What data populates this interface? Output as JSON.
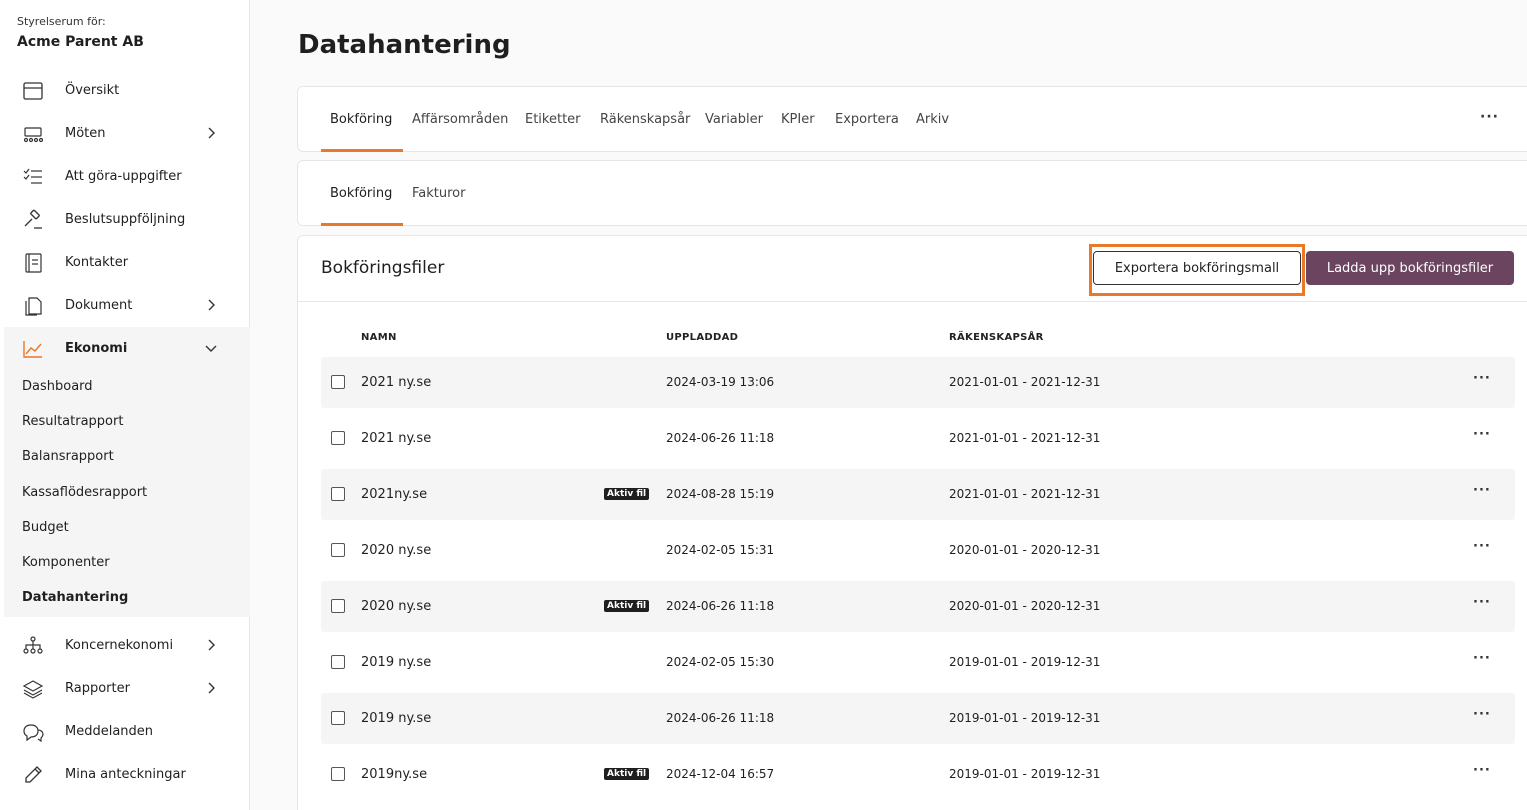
{
  "org": {
    "label": "Styrelserum för:",
    "name": "Acme Parent AB"
  },
  "nav": {
    "oversikt": "Översikt",
    "moten": "Möten",
    "todo": "Att göra-uppgifter",
    "beslut": "Beslutsuppföljning",
    "kontakter": "Kontakter",
    "dokument": "Dokument",
    "ekonomi": "Ekonomi",
    "koncern": "Koncernekonomi",
    "rapporter": "Rapporter",
    "meddelanden": "Meddelanden",
    "anteckningar": "Mina anteckningar"
  },
  "ekonomi_sub": {
    "dashboard": "Dashboard",
    "resultat": "Resultatrapport",
    "balans": "Balansrapport",
    "kassaflode": "Kassaflödesrapport",
    "budget": "Budget",
    "komponenter": "Komponenter",
    "datahantering": "Datahantering"
  },
  "page": {
    "title": "Datahantering"
  },
  "tabs": {
    "bokforing": "Bokföring",
    "affarsomraden": "Affärsområden",
    "etiketter": "Etiketter",
    "rakenskapsar": "Räkenskapsår",
    "variabler": "Variabler",
    "kpier": "KPIer",
    "exportera": "Exportera",
    "arkiv": "Arkiv",
    "more": "···"
  },
  "subtabs": {
    "bokforing": "Bokföring",
    "fakturor": "Fakturor"
  },
  "files": {
    "title": "Bokföringsfiler",
    "export_button": "Exportera bokföringsmall",
    "upload_button": "Ladda upp bokföringsfiler",
    "columns": {
      "name": "NAMN",
      "uploaded": "UPPLADDAD",
      "year": "RÄKENSKAPSÅR"
    },
    "badge_label": "Aktiv fil",
    "row_menu": "···",
    "rows": [
      {
        "name": "2021 ny.se",
        "uploaded": "2024-03-19 13:06",
        "year": "2021-01-01 - 2021-12-31",
        "active": false
      },
      {
        "name": "2021 ny.se",
        "uploaded": "2024-06-26 11:18",
        "year": "2021-01-01 - 2021-12-31",
        "active": false
      },
      {
        "name": "2021ny.se",
        "uploaded": "2024-08-28 15:19",
        "year": "2021-01-01 - 2021-12-31",
        "active": true
      },
      {
        "name": "2020 ny.se",
        "uploaded": "2024-02-05 15:31",
        "year": "2020-01-01 - 2020-12-31",
        "active": false
      },
      {
        "name": "2020 ny.se",
        "uploaded": "2024-06-26 11:18",
        "year": "2020-01-01 - 2020-12-31",
        "active": true
      },
      {
        "name": "2019 ny.se",
        "uploaded": "2024-02-05 15:30",
        "year": "2019-01-01 - 2019-12-31",
        "active": false
      },
      {
        "name": "2019 ny.se",
        "uploaded": "2024-06-26 11:18",
        "year": "2019-01-01 - 2019-12-31",
        "active": false
      },
      {
        "name": "2019ny.se",
        "uploaded": "2024-12-04 16:57",
        "year": "2019-01-01 - 2019-12-31",
        "active": true
      }
    ]
  },
  "colors": {
    "accent": "#e8782a",
    "primary_button": "#6b4560"
  }
}
